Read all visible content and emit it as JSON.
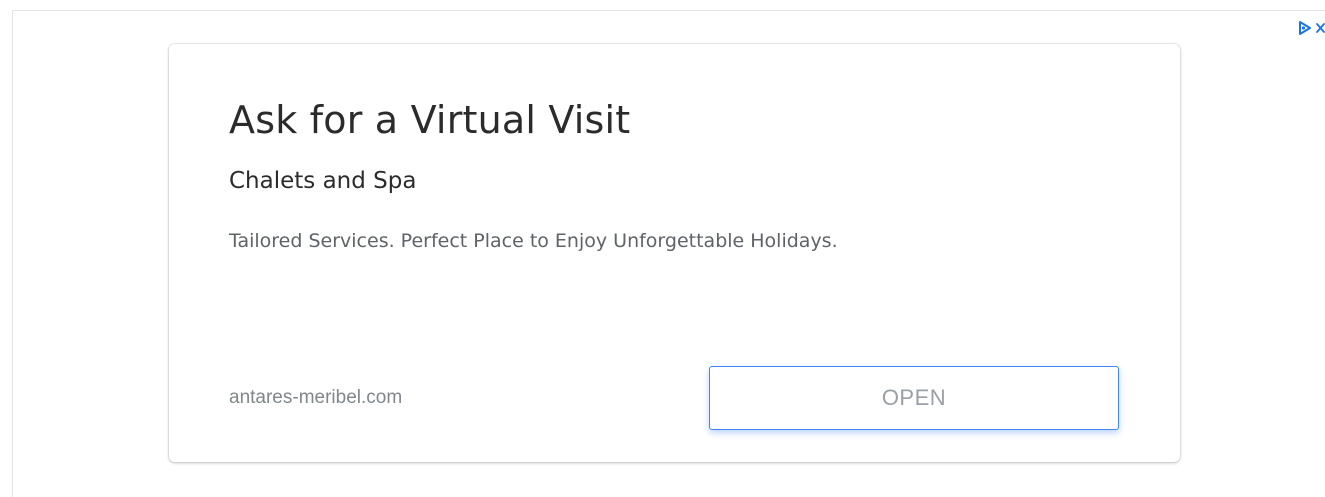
{
  "ad": {
    "headline": "Ask for a Virtual Visit",
    "advertiser": "Chalets and Spa",
    "description": "Tailored Services. Perfect Place to Enjoy Unforgettable Holidays.",
    "display_url": "antares-meribel.com",
    "cta_label": "OPEN"
  },
  "adchoices": {
    "icons": [
      "adchoices-play-icon",
      "close-icon"
    ],
    "accent_color": "#1a73e8"
  },
  "colors": {
    "headline": "#2b2b2b",
    "description": "#5f6368",
    "url": "#80868b",
    "button_border": "#4285f4",
    "button_text": "#9aa0a6"
  }
}
